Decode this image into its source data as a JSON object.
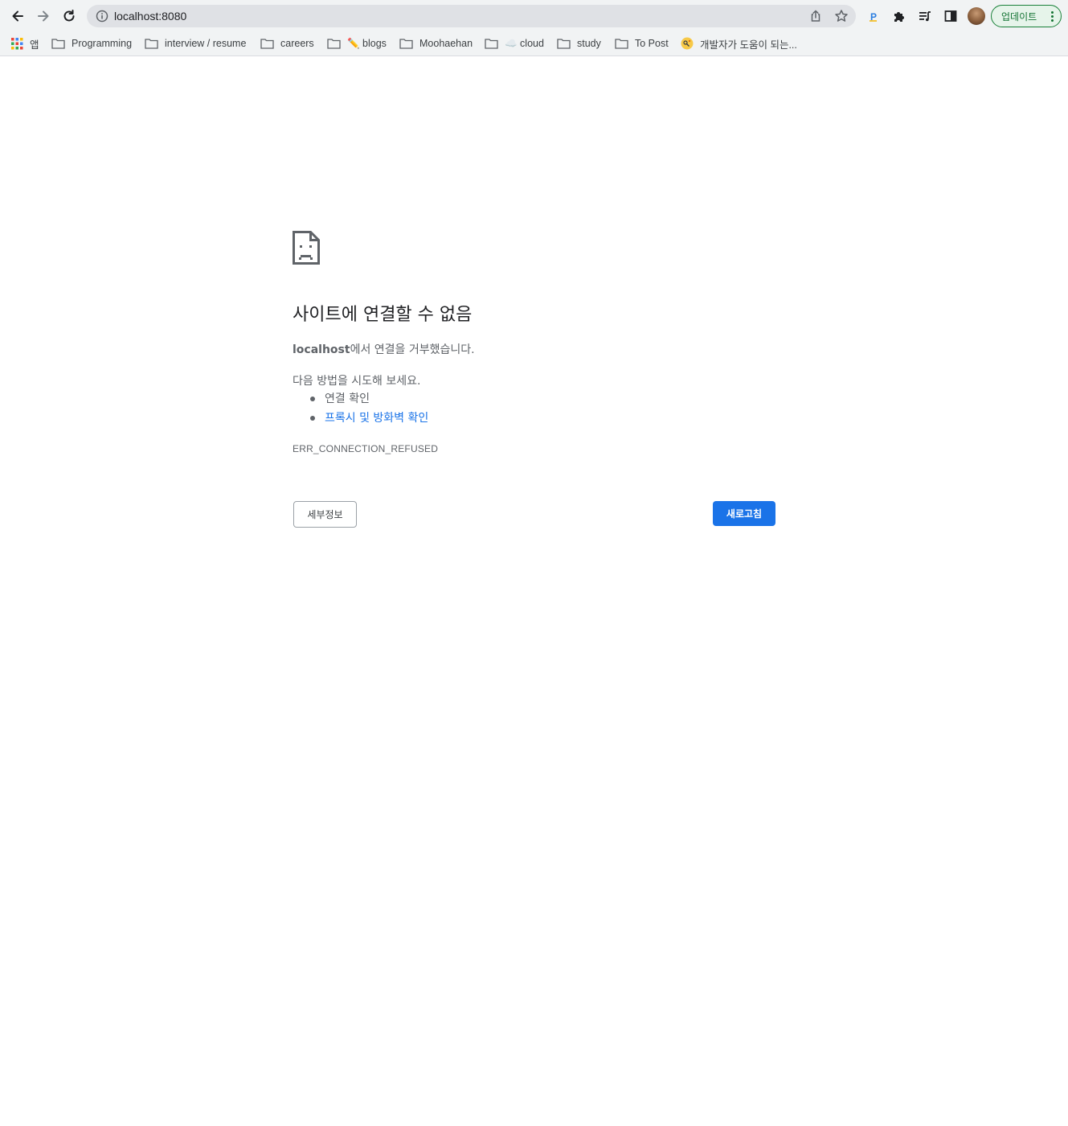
{
  "browser": {
    "url": "localhost:8080",
    "update_button_label": "업데이트",
    "accent_color": "#1a73e8"
  },
  "bookmarks": [
    {
      "label": "앱",
      "icon": "apps-grid-icon"
    },
    {
      "label": "Programming",
      "icon": "folder-icon"
    },
    {
      "label": "interview / resume",
      "icon": "folder-icon"
    },
    {
      "label": "careers",
      "icon": "folder-icon"
    },
    {
      "label": "✏️ blogs",
      "icon": "folder-icon"
    },
    {
      "label": "Moohaehan",
      "icon": "folder-icon"
    },
    {
      "label": "☁️ cloud",
      "icon": "folder-icon"
    },
    {
      "label": "study",
      "icon": "folder-icon"
    },
    {
      "label": "To Post",
      "icon": "folder-icon"
    },
    {
      "label": "개발자가 도움이 되는...",
      "icon": "site-favicon"
    }
  ],
  "error": {
    "title": "사이트에 연결할 수 없음",
    "host": "localhost",
    "desc_suffix": "에서 연결을 거부했습니다.",
    "suggest_heading": "다음 방법을 시도해 보세요.",
    "suggestions": [
      "연결 확인",
      "프록시 및 방화벽 확인"
    ],
    "code": "ERR_CONNECTION_REFUSED",
    "details_button": "세부정보",
    "reload_button": "새로고침"
  }
}
